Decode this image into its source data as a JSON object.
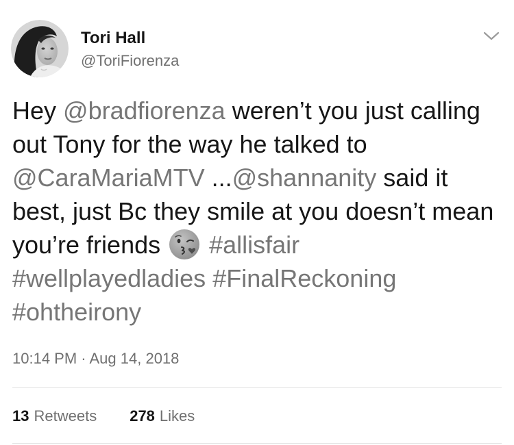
{
  "tweet": {
    "author": {
      "name": "Tori Hall",
      "handle": "@ToriFiorenza"
    },
    "lines": [
      [
        {
          "text": "Hey ",
          "kind": "text"
        },
        {
          "text": "@bradfiorenza",
          "kind": "mention"
        },
        {
          "text": " weren’t you just calling",
          "kind": "text"
        }
      ],
      [
        {
          "text": "out Tony for the way he talked to",
          "kind": "text"
        }
      ],
      [
        {
          "text": "@CaraMariaMTV",
          "kind": "mention"
        },
        {
          "text": " ...",
          "kind": "text"
        },
        {
          "text": "@shannanity",
          "kind": "mention"
        },
        {
          "text": " said it",
          "kind": "text"
        }
      ],
      [
        {
          "text": "best, just Bc they smile at you doesn’t mean",
          "kind": "text"
        }
      ],
      [
        {
          "text": "you’re friends ",
          "kind": "text"
        },
        {
          "emoji": "face-blowing-a-kiss",
          "kind": "emoji"
        },
        {
          "text": " ",
          "kind": "text"
        },
        {
          "text": "#allisfair",
          "kind": "hashtag"
        }
      ],
      [
        {
          "text": "#wellplayedladies",
          "kind": "hashtag"
        },
        {
          "text": " ",
          "kind": "text"
        },
        {
          "text": "#FinalReckoning",
          "kind": "hashtag"
        }
      ],
      [
        {
          "text": "#ohtheirony",
          "kind": "hashtag"
        }
      ]
    ],
    "timestamp": "10:14 PM · Aug 14, 2018",
    "stats": {
      "retweets_count": "13",
      "retweets_label": "Retweets",
      "likes_count": "278",
      "likes_label": "Likes"
    }
  },
  "icons": {
    "menu": "chevron-down-icon",
    "emoji": "face-blowing-a-kiss"
  },
  "colors": {
    "text": "#161616",
    "link": "#767676",
    "secondary": "#707070",
    "divider": "#e0e0e0"
  }
}
